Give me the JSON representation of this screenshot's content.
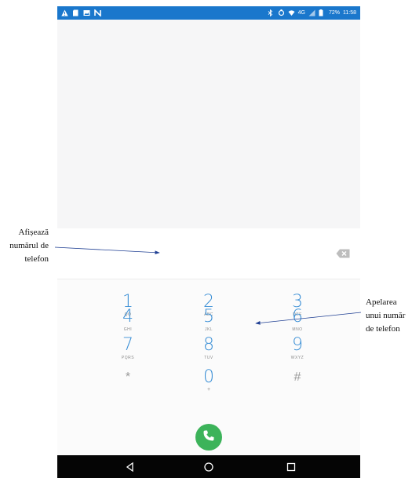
{
  "status_bar": {
    "left_icons": [
      "warning-icon",
      "sim-icon",
      "image-icon",
      "n-icon"
    ],
    "network": "4G",
    "battery": "72%",
    "time": "11:58"
  },
  "dialer": {
    "number": "",
    "keys": [
      {
        "digit": "1",
        "letters": "QO"
      },
      {
        "digit": "2",
        "letters": "ABC"
      },
      {
        "digit": "3",
        "letters": "DEF"
      },
      {
        "digit": "4",
        "letters": "GHI"
      },
      {
        "digit": "5",
        "letters": "JKL"
      },
      {
        "digit": "6",
        "letters": "MNO"
      },
      {
        "digit": "7",
        "letters": "PQRS"
      },
      {
        "digit": "8",
        "letters": "TUV"
      },
      {
        "digit": "9",
        "letters": "WXYZ"
      },
      {
        "digit": "*",
        "letters": ""
      },
      {
        "digit": "0",
        "letters": "+"
      },
      {
        "digit": "#",
        "letters": ""
      }
    ]
  },
  "annotations": {
    "left": "Afișează numărul de telefon",
    "right": "Apelarea unui număr de telefon"
  },
  "colors": {
    "status_bar": "#1a77cc",
    "digit": "#3a8fd6",
    "call": "#3cb35a",
    "nav_bar": "#050505"
  }
}
